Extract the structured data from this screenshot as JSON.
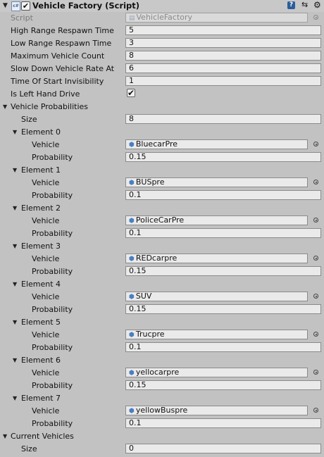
{
  "header": {
    "title": "Vehicle Factory (Script)",
    "script_icon_text": "c#",
    "enabled_check": "✔",
    "help_glyph": "?",
    "preset_glyph": "⇆",
    "gear_glyph": "⚙"
  },
  "script": {
    "label": "Script",
    "value": "VehicleFactory"
  },
  "fields": [
    {
      "label": "High Range Respawn Time",
      "value": "5"
    },
    {
      "label": "Low Range Respawn Time",
      "value": "3"
    },
    {
      "label": "Maximum Vehicle Count",
      "value": "8"
    },
    {
      "label": "Slow Down Vehicle Rate At",
      "value": "6"
    },
    {
      "label": "Time Of Start Invisibility",
      "value": "1"
    }
  ],
  "left_hand_drive": {
    "label": "Is Left Hand Drive",
    "checked_glyph": "✔"
  },
  "vehicle_probabilities": {
    "label": "Vehicle Probabilities",
    "size_label": "Size",
    "size": "8",
    "elements": [
      {
        "name": "Element 0",
        "vehicle_label": "Vehicle",
        "vehicle": "BluecarPre",
        "prob_label": "Probability",
        "probability": "0.15"
      },
      {
        "name": "Element 1",
        "vehicle_label": "Vehicle",
        "vehicle": "BUSpre",
        "prob_label": "Probability",
        "probability": "0.1"
      },
      {
        "name": "Element 2",
        "vehicle_label": "Vehicle",
        "vehicle": "PoliceCarPre",
        "prob_label": "Probability",
        "probability": "0.1"
      },
      {
        "name": "Element 3",
        "vehicle_label": "Vehicle",
        "vehicle": "REDcarpre",
        "prob_label": "Probability",
        "probability": "0.15"
      },
      {
        "name": "Element 4",
        "vehicle_label": "Vehicle",
        "vehicle": "SUV",
        "prob_label": "Probability",
        "probability": "0.15"
      },
      {
        "name": "Element 5",
        "vehicle_label": "Vehicle",
        "vehicle": "Trucpre",
        "prob_label": "Probability",
        "probability": "0.1"
      },
      {
        "name": "Element 6",
        "vehicle_label": "Vehicle",
        "vehicle": "yellocarpre",
        "prob_label": "Probability",
        "probability": "0.15"
      },
      {
        "name": "Element 7",
        "vehicle_label": "Vehicle",
        "vehicle": "yellowBuspre",
        "prob_label": "Probability",
        "probability": "0.1"
      }
    ]
  },
  "current_vehicles": {
    "label": "Current Vehicles",
    "size_label": "Size",
    "size": "0"
  },
  "icons": {
    "expanded": "▼",
    "prefab_cube": "⬢"
  }
}
